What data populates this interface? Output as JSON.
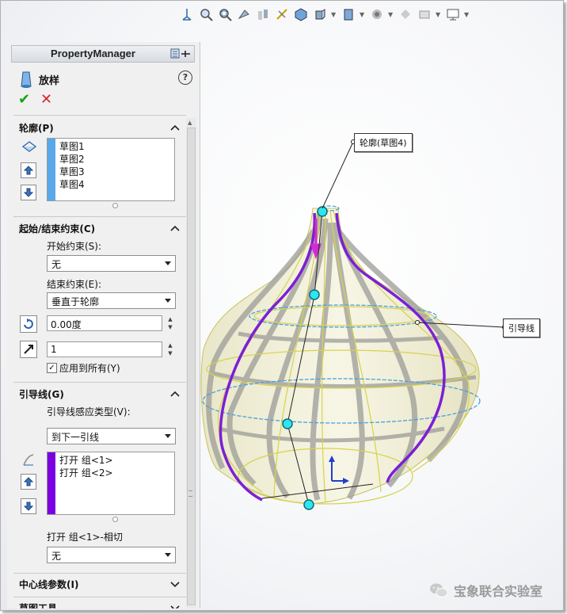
{
  "property_manager": {
    "title": "PropertyManager",
    "feature_name": "放样",
    "help": "?",
    "ok": "✔",
    "cancel": "✕"
  },
  "profiles": {
    "title": "轮廓(P)",
    "items": [
      "草图1",
      "草图2",
      "草图3",
      "草图4"
    ],
    "strip_color": "#5aa8ea"
  },
  "start_end": {
    "title": "起始/结束约束(C)",
    "start_label": "开始约束(S):",
    "start_value": "无",
    "end_label": "结束约束(E):",
    "end_value": "垂直于轮廓",
    "angle_value": "0.00度",
    "length_value": "1",
    "apply_all_label": "应用到所有(Y)",
    "apply_all_checked": true
  },
  "guides": {
    "title": "引导线(G)",
    "type_label": "引导线感应类型(V):",
    "type_value": "到下一引线",
    "items": [
      "打开 组<1>",
      "打开 组<2>"
    ],
    "strip_color": "#7a00e0",
    "tangent_label": "打开 组<1>-相切",
    "tangent_value": "无"
  },
  "centerline": {
    "title": "中心线参数(I)"
  },
  "next_section": {
    "title": "草图工具"
  },
  "viewport": {
    "callout_profile": "轮廓(草图4)",
    "callout_guide": "引导线"
  },
  "watermark": {
    "text": "宝象联合实验室"
  },
  "colors": {
    "guide": "#7b1fd6",
    "handle": "#2ee6f0",
    "mesh": "#d8d24a"
  }
}
